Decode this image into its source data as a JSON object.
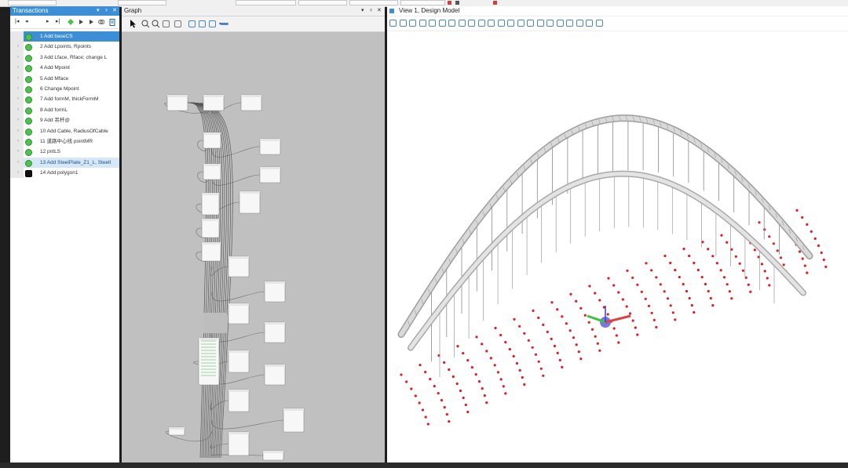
{
  "transactions": {
    "title": "Transactions",
    "controls": [
      "▾",
      "♀",
      "✕"
    ],
    "toolbar": [
      "|◂",
      "◂",
      "▸",
      "▸|"
    ],
    "rows": [
      {
        "label": "1  Add baseCS",
        "state": "selected"
      },
      {
        "label": "2  Add Lpoints, Rpoints",
        "state": "normal"
      },
      {
        "label": "3  Add Lface, Rface; change L",
        "state": "normal"
      },
      {
        "label": "4  Add Mpoint",
        "state": "normal"
      },
      {
        "label": "5  Add Mface",
        "state": "normal"
      },
      {
        "label": "6  Change Mpoint",
        "state": "normal"
      },
      {
        "label": "7  Add formM, thickFormM",
        "state": "normal"
      },
      {
        "label": "8  Add formL",
        "state": "normal"
      },
      {
        "label": "9  Add 吊杆@",
        "state": "normal"
      },
      {
        "label": "10  Add Cable, RadiusOfCable",
        "state": "normal"
      },
      {
        "label": "11  道路中心线 pointMR",
        "state": "normal"
      },
      {
        "label": "12  pntLS",
        "state": "normal"
      },
      {
        "label": "13  Add SteelPlate_Z1_L, SteelI",
        "state": "highlight"
      },
      {
        "label": "14  Add polygon1",
        "state": "last"
      }
    ]
  },
  "graph": {
    "title": "Graph",
    "controls": [
      "▾",
      "♀",
      "✕"
    ]
  },
  "view": {
    "title": "View 1, Design Model",
    "accent": "#3c8fd6",
    "point_color": "#e31b23"
  },
  "icons": [
    "pointer-icon",
    "zoom-in-icon",
    "zoom-out-icon",
    "fit-view-icon",
    "rotate-icon",
    "pan-icon",
    "window-area-icon"
  ]
}
